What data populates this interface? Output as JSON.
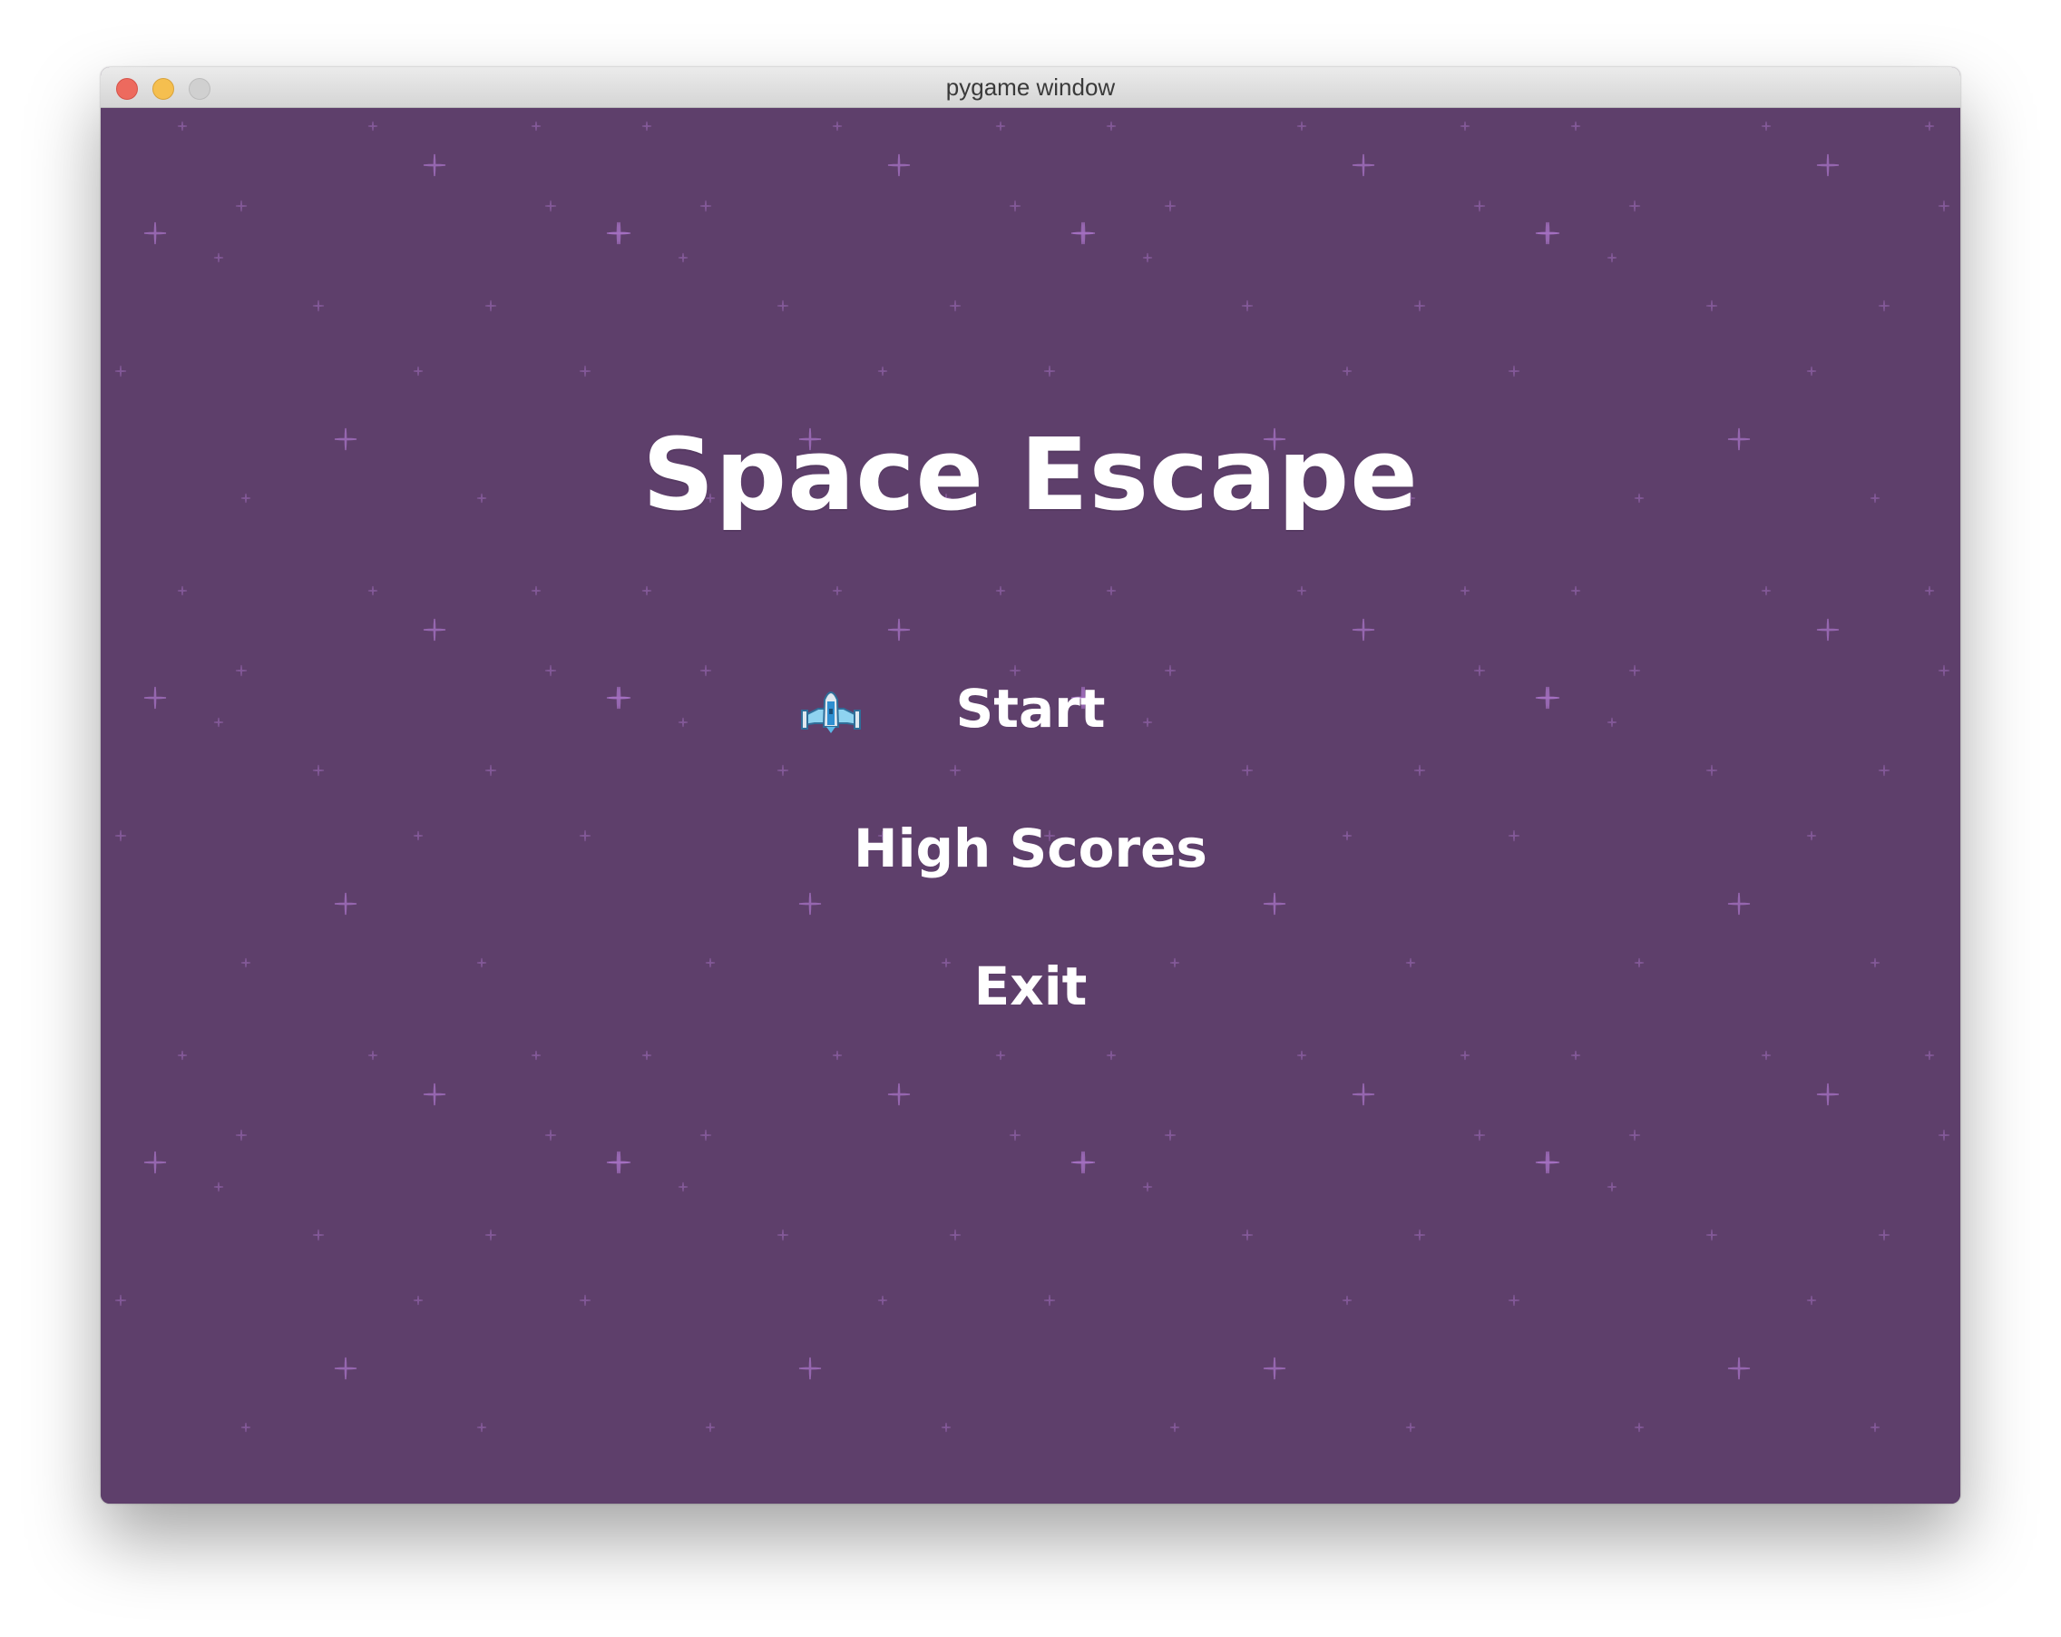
{
  "window": {
    "title": "pygame window",
    "controls": [
      "close",
      "minimize",
      "zoom"
    ]
  },
  "game": {
    "title": "Space Escape",
    "background_color": "#5e3f6b",
    "star_color": "#a873c6",
    "menu": {
      "items": [
        {
          "label": "Start",
          "selected": true
        },
        {
          "label": "High Scores",
          "selected": false
        },
        {
          "label": "Exit",
          "selected": false
        }
      ],
      "selection_icon": "spaceship-icon"
    }
  }
}
